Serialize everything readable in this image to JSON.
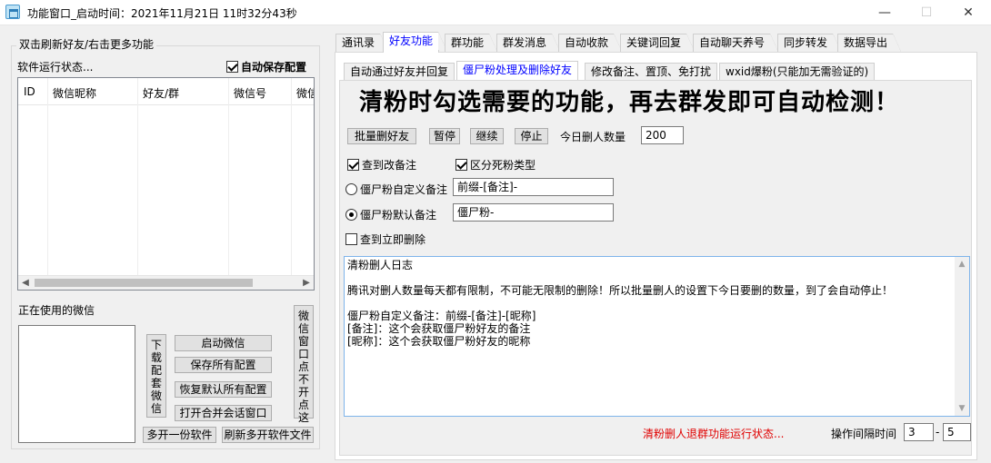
{
  "window": {
    "title": "功能窗口_启动时间：2021年11月21日 11时32分43秒",
    "controls": {
      "minimize": "—",
      "maximize": "☐",
      "close": "✕"
    }
  },
  "left": {
    "group_title": "双击刷新好友/右击更多功能",
    "status_label": "软件运行状态...",
    "autosave_label": "自动保存配置",
    "autosave_checked": true,
    "table_columns": [
      "ID",
      "微信昵称",
      "好友/群",
      "微信号",
      "微信"
    ],
    "in_use_label": "正在使用的微信",
    "buttons": {
      "download": "下载配套微信",
      "start_wechat": "启动微信",
      "save_all": "保存所有配置",
      "restore_default": "恢复默认所有配置",
      "open_merge": "打开合并会话窗口",
      "window_note": "微信窗口点不开点这",
      "multi_open": "多开一份软件",
      "refresh_multi": "刷新多开软件文件"
    }
  },
  "tabs": [
    "通讯录",
    "好友功能",
    "群功能",
    "群发消息",
    "自动收款",
    "关键词回复",
    "自动聊天养号",
    "同步转发",
    "数据导出"
  ],
  "active_tab": "好友功能",
  "subtabs": [
    "自动通过好友并回复",
    "僵尸粉处理及删除好友",
    "修改备注、置顶、免打扰",
    "wxid爆粉(只能加无需验证的)"
  ],
  "active_subtab": "僵尸粉处理及删除好友",
  "panel": {
    "headline": "清粉时勾选需要的功能，再去群发即可自动检测！",
    "btn_batch_delete": "批量删好友",
    "btn_pause": "暂停",
    "btn_continue": "继续",
    "btn_stop": "停止",
    "daily_delete_label": "今日删人数量",
    "daily_delete_value": "200",
    "chk_modify_remark": "查到改备注",
    "chk_modify_remark_checked": true,
    "chk_distinguish": "区分死粉类型",
    "chk_distinguish_checked": true,
    "radio_custom_remark": "僵尸粉自定义备注",
    "radio_custom_remark_selected": false,
    "custom_remark_value": "前缀-[备注]-",
    "radio_default_remark": "僵尸粉默认备注",
    "radio_default_remark_selected": true,
    "default_remark_value": "僵尸粉-",
    "chk_delete_now": "查到立即删除",
    "chk_delete_now_checked": false,
    "log_text": "清粉删人日志\n\n腾讯对删人数量每天都有限制，不可能无限制的删除！所以批量删人的设置下今日要删的数量，到了会自动停止！\n\n僵尸粉自定义备注：前缀-[备注]-[昵称]\n[备注]：这个会获取僵尸粉好友的备注\n[昵称]：这个会获取僵尸粉好友的昵称",
    "status_text": "清粉删人退群功能运行状态...",
    "interval_label": "操作间隔时间",
    "interval_min": "3",
    "interval_sep": "-",
    "interval_max": "5"
  },
  "colors": {
    "active_tab": "#0000ff",
    "status_red": "#e00000",
    "log_border": "#7eb4ea"
  }
}
